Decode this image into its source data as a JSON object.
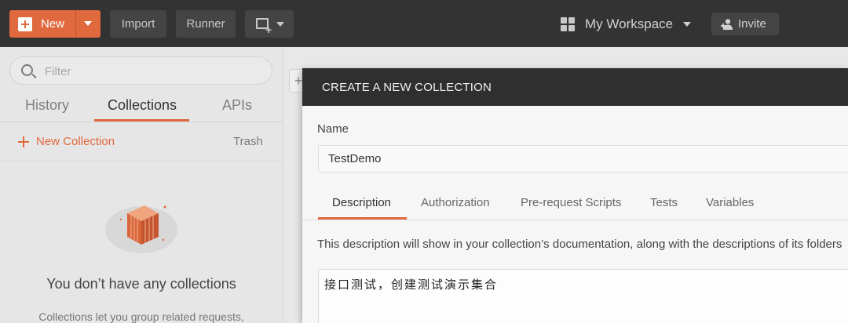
{
  "topbar": {
    "new_label": "New",
    "import_label": "Import",
    "runner_label": "Runner",
    "workspace_label": "My Workspace",
    "invite_label": "Invite",
    "icons": {
      "new": "plus-box-icon",
      "new_dropdown": "caret-down-icon",
      "new_window": "new-window-icon",
      "workspace": "grid-icon",
      "invite": "add-user-icon"
    }
  },
  "sidebar": {
    "filter_placeholder": "Filter",
    "tabs": [
      {
        "label": "History",
        "active": false
      },
      {
        "label": "Collections",
        "active": true
      },
      {
        "label": "APIs",
        "active": false
      }
    ],
    "new_collection_label": "New Collection",
    "trash_label": "Trash",
    "empty_title": "You don’t have any collections",
    "empty_subtitle": "Collections let you group related requests,"
  },
  "modal": {
    "title": "CREATE A NEW COLLECTION",
    "name_label": "Name",
    "name_value": "TestDemo",
    "tabs": [
      {
        "label": "Description",
        "active": true
      },
      {
        "label": "Authorization",
        "active": false
      },
      {
        "label": "Pre-request Scripts",
        "active": false
      },
      {
        "label": "Tests",
        "active": false
      },
      {
        "label": "Variables",
        "active": false
      }
    ],
    "description_hint": "This description will show in your collection’s documentation, along with the descriptions of its folders",
    "description_value": "接口测试，创建测试演示集合"
  },
  "colors": {
    "accent": "#e0693e",
    "topbar_bg": "#333333",
    "modal_header_bg": "#2f2f2f"
  }
}
